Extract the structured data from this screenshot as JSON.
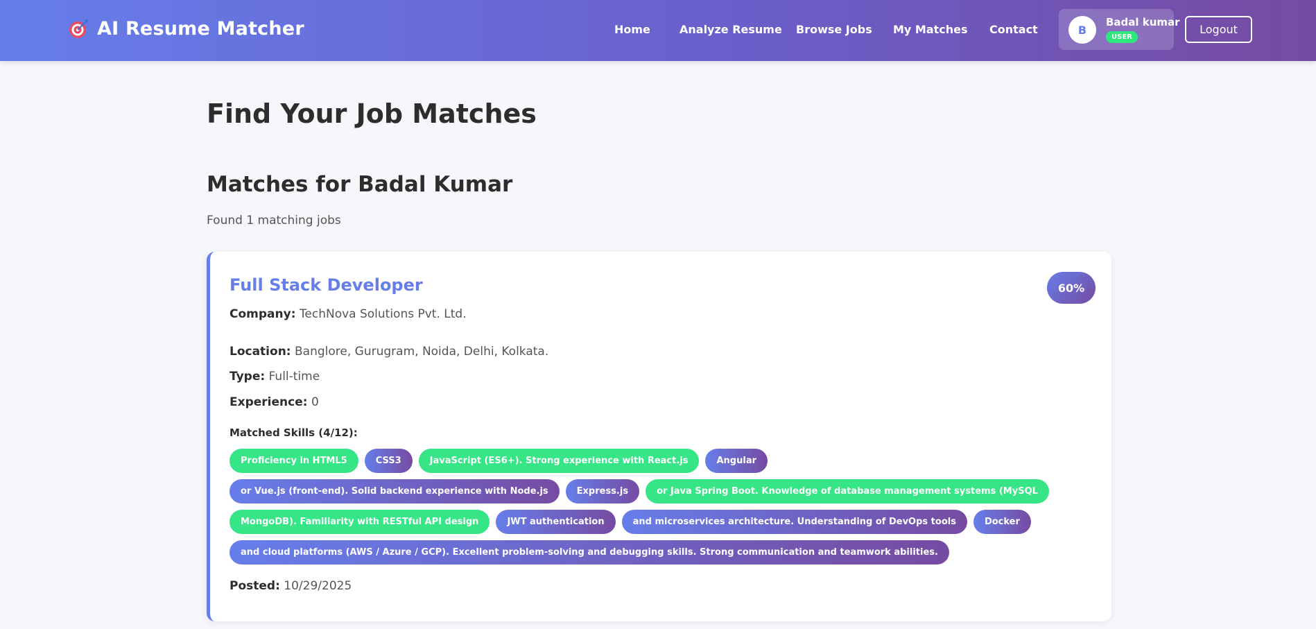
{
  "header": {
    "brand": "AI Resume Matcher",
    "brand_icon": "target-icon",
    "nav": [
      "Home",
      "Analyze Resume",
      "Browse Jobs",
      "My Matches",
      "Contact"
    ],
    "user": {
      "initial": "B",
      "name": "Badal kumar",
      "role": "USER"
    },
    "logout_label": "Logout"
  },
  "main": {
    "page_title": "Find Your Job Matches",
    "section_title": "Matches for Badal Kumar",
    "results_count": "Found 1 matching jobs",
    "job": {
      "title": "Full Stack Developer",
      "score": "60%",
      "company_label": "Company:",
      "company": "TechNova Solutions Pvt. Ltd.",
      "location_label": "Location:",
      "location": "Banglore, Gurugram, Noida, Delhi, Kolkata.",
      "type_label": "Type:",
      "type": "Full-time",
      "experience_label": "Experience:",
      "experience": "0",
      "skills_label": "Matched Skills (4/12):",
      "skills": [
        {
          "text": "Proficiency in HTML5",
          "matched": true
        },
        {
          "text": "CSS3",
          "matched": false
        },
        {
          "text": "JavaScript (ES6+). Strong experience with React.js",
          "matched": true
        },
        {
          "text": "Angular",
          "matched": false
        },
        {
          "text": "or Vue.js (front-end). Solid backend experience with Node.js",
          "matched": false
        },
        {
          "text": "Express.js",
          "matched": false
        },
        {
          "text": "or Java Spring Boot. Knowledge of database management systems (MySQL",
          "matched": true
        },
        {
          "text": "MongoDB). Familiarity with RESTful API design",
          "matched": true
        },
        {
          "text": "JWT authentication",
          "matched": false
        },
        {
          "text": "and microservices architecture. Understanding of DevOps tools",
          "matched": false
        },
        {
          "text": "Docker",
          "matched": false
        },
        {
          "text": "and cloud platforms (AWS / Azure / GCP). Excellent problem-solving and debugging skills. Strong communication and teamwork abilities.",
          "matched": false
        }
      ],
      "posted_label": "Posted:",
      "posted": "10/29/2025"
    }
  },
  "colors": {
    "primary": "#667eea",
    "secondary": "#764ba2",
    "matched": "#36e585",
    "background": "#f5f7fa"
  }
}
